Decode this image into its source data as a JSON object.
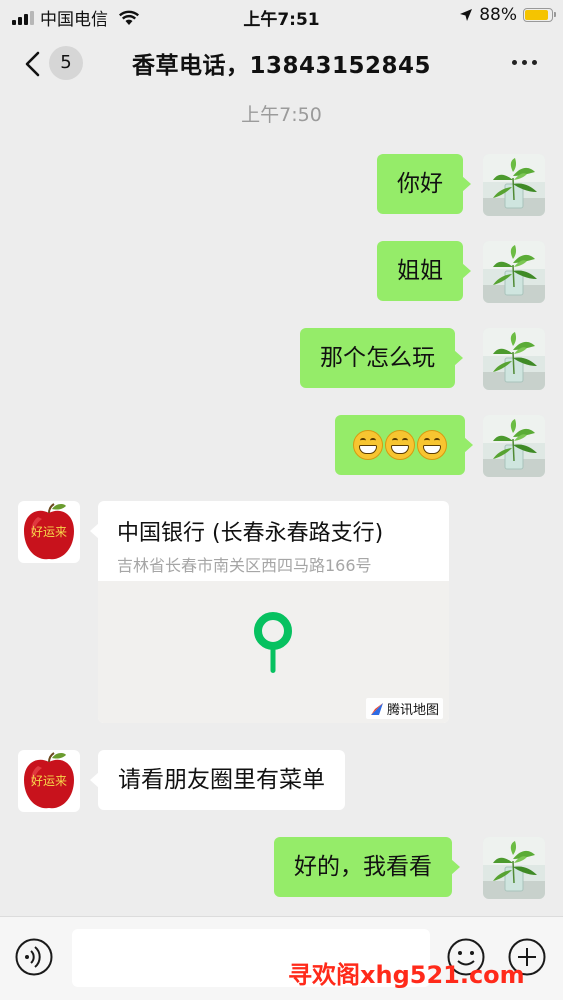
{
  "status_bar": {
    "carrier": "中国电信",
    "time": "上午7:51",
    "battery": "88%",
    "battery_level": 0.88
  },
  "nav": {
    "unread_count": "5",
    "title": "香草电话，13843152845"
  },
  "timestamp": "上午7:50",
  "messages": [
    {
      "side": "right",
      "text": "你好"
    },
    {
      "side": "right",
      "text": "姐姐"
    },
    {
      "side": "right",
      "text": "那个怎么玩"
    },
    {
      "side": "right",
      "emoji": [
        "grin",
        "grin",
        "grin"
      ]
    },
    {
      "side": "left",
      "location": {
        "name": "中国银行 (长春永春路支行)",
        "address": "吉林省长春市南关区西四马路166号",
        "map_brand": "腾讯地图"
      }
    },
    {
      "side": "left",
      "text": "请看朋友圈里有菜单"
    },
    {
      "side": "right",
      "text": "好的，我看看"
    }
  ],
  "avatars": {
    "self_icon": "plant-in-glass",
    "contact_label": "好运来"
  },
  "input": {
    "value": "",
    "placeholder": ""
  },
  "watermark": "寻欢阁xhg521.com",
  "colors": {
    "background": "#ededed",
    "sent_bubble": "#95ec69",
    "received_bubble": "#ffffff",
    "map_pin": "#07c160",
    "watermark": "#ff2a1a"
  }
}
